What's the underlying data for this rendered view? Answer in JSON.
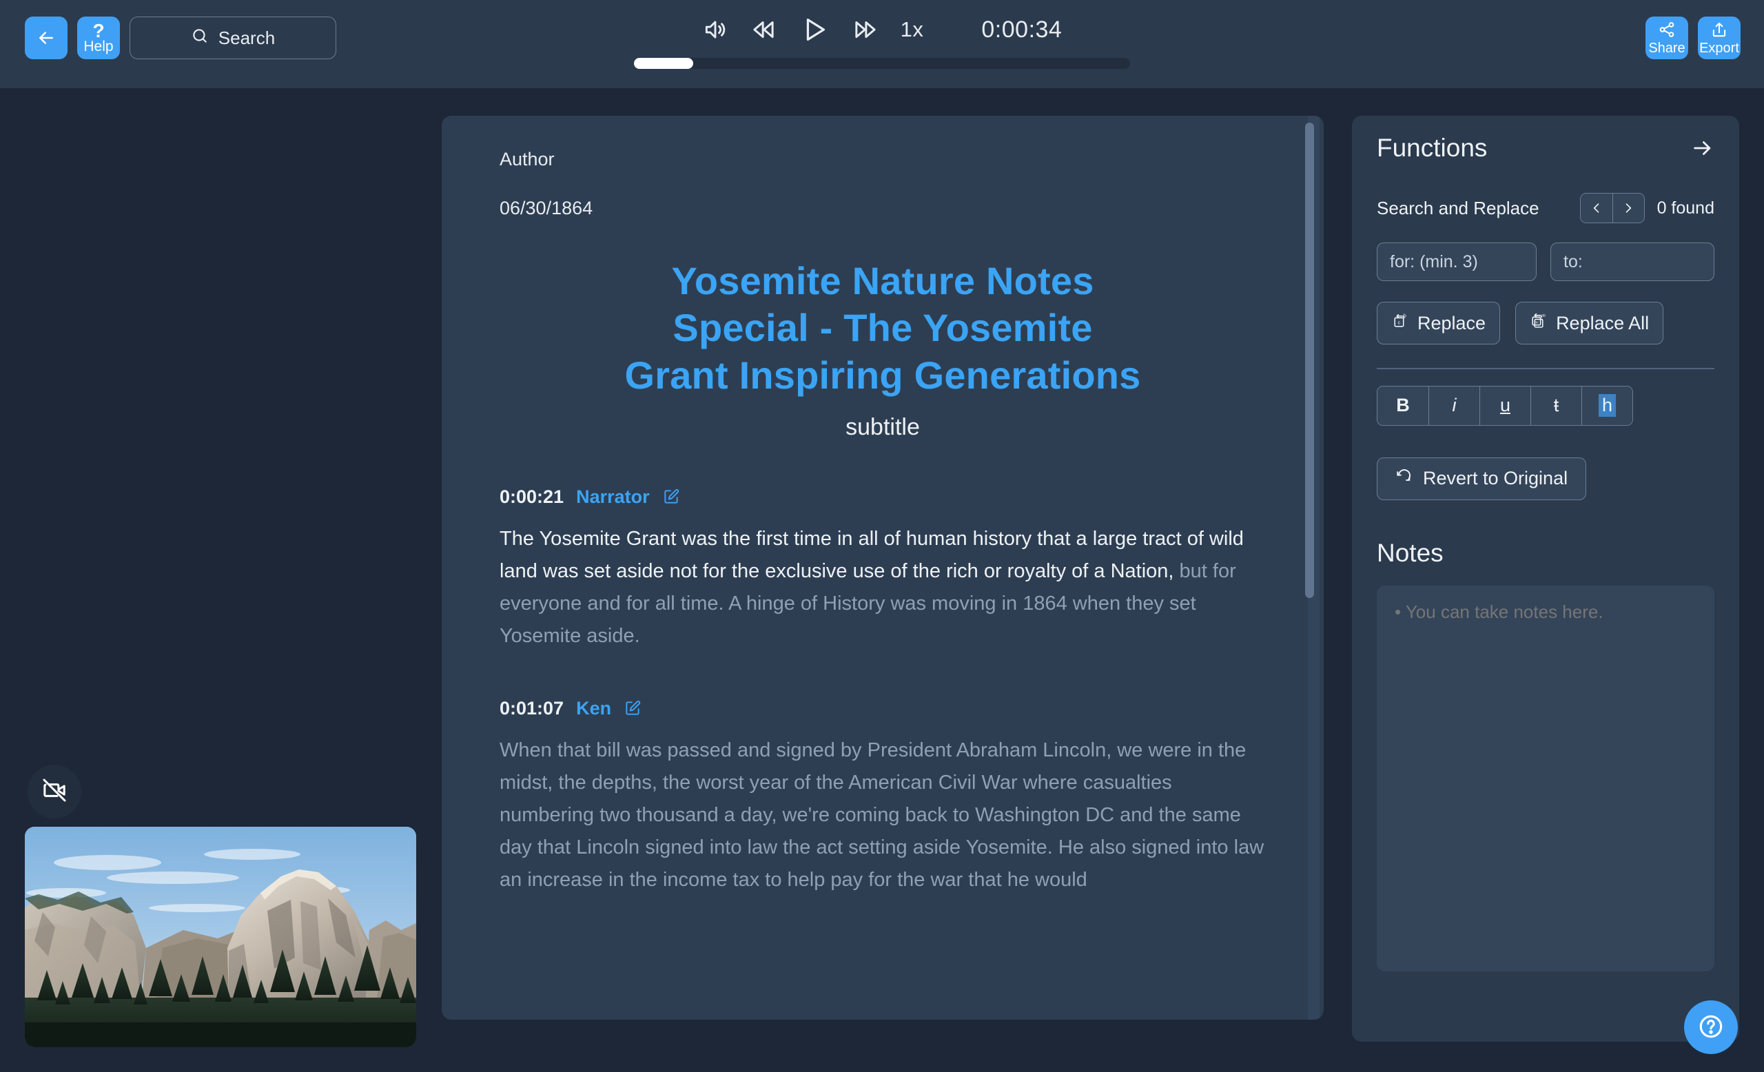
{
  "toolbar": {
    "back_label": "Back",
    "help_mark": "?",
    "help_label": "Help",
    "search_label": "Search",
    "share_label": "Share",
    "export_label": "Export"
  },
  "player": {
    "speed": "1x",
    "timecode": "0:00:34",
    "progress_percent": 12,
    "volume_icon": "volume-icon",
    "rewind_icon": "rewind-icon",
    "play_icon": "play-icon",
    "forward_icon": "fast-forward-icon"
  },
  "video": {
    "camera_off_icon": "camera-off-icon",
    "thumbnail_alt": "Yosemite Half Dome"
  },
  "document": {
    "author": "Author",
    "date": "06/30/1864",
    "title": "Yosemite Nature Notes Special - The Yosemite Grant Inspiring Generations",
    "title_lines": [
      "Yosemite Nature Notes",
      "Special - The Yosemite",
      "Grant Inspiring Generations"
    ],
    "subtitle": "subtitle",
    "segments": [
      {
        "time": "0:00:21",
        "speaker": "Narrator",
        "spoken": "The Yosemite Grant was the first time in all of human history that a large tract of wild land was set aside not for the exclusive use of the rich or royalty of a Nation,",
        "unspoken": " but for everyone and for all time. A hinge of History was moving in 1864 when they set Yosemite aside."
      },
      {
        "time": "0:01:07",
        "speaker": "Ken",
        "spoken": "",
        "unspoken": "When that bill was passed and signed by President Abraham Lincoln, we were in the midst, the depths, the worst year of the American Civil War where casualties numbering two thousand a day, we're coming back to Washington DC and the same day that Lincoln signed into law the act setting aside Yosemite. He also signed into law an increase in the income tax to help pay for the war that he would"
      }
    ]
  },
  "functions": {
    "title": "Functions",
    "collapse_icon": "arrow-right-icon",
    "search_replace_label": "Search and Replace",
    "prev_label": "‹",
    "next_label": "›",
    "found_text": "0 found",
    "find_placeholder": "for: (min. 3)",
    "find_value": "",
    "replace_placeholder": "to:",
    "replace_value": "",
    "replace_label": "Replace",
    "replace_all_label": "Replace All",
    "format_buttons": [
      {
        "name": "bold",
        "label": "B"
      },
      {
        "name": "italic",
        "label": "i"
      },
      {
        "name": "underline",
        "label": "u"
      },
      {
        "name": "strikethrough",
        "label": "ŧ"
      },
      {
        "name": "highlight",
        "label": "h"
      }
    ],
    "active_format": "highlight",
    "revert_label": "Revert to Original"
  },
  "notes": {
    "title": "Notes",
    "placeholder": "• You can take notes here.",
    "value": ""
  },
  "fab": {
    "help_icon": "question-circle-icon"
  },
  "colors": {
    "accent": "#3fa0f5",
    "title_blue": "#3ba4f5",
    "page_bg": "#1d2737",
    "card_bg": "#2e3e52",
    "panel_bg": "#2b3a4d",
    "text_primary": "#eef2f6",
    "text_dim": "#8fa0b4",
    "highlight": "#3d82c4"
  }
}
